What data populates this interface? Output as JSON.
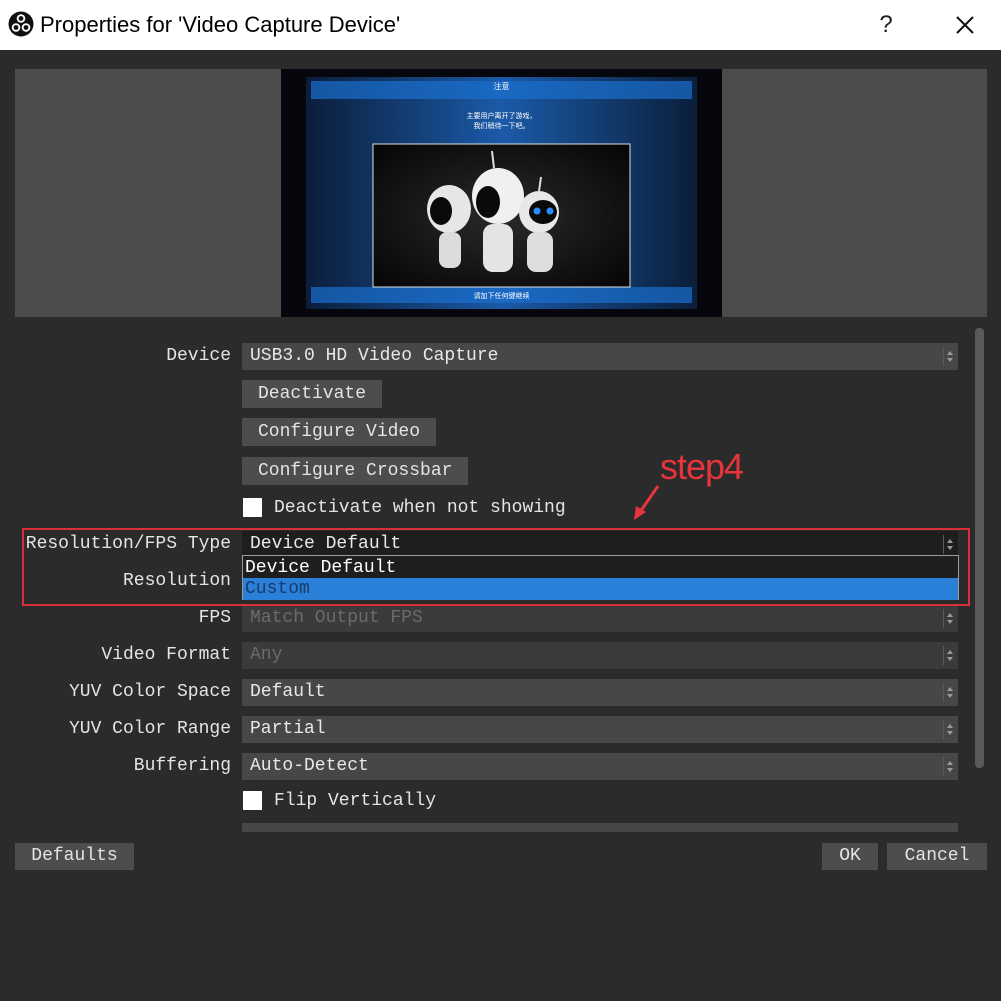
{
  "window": {
    "title": "Properties for 'Video Capture Device'",
    "help_glyph": "?"
  },
  "preview": {
    "header_text": "注意",
    "message_line1": "主要用户离开了游戏，",
    "message_line2": "我们稍待一下吧。",
    "footer_text": "请加下任何键继续"
  },
  "properties": {
    "device": {
      "label": "Device",
      "value": "USB3.0 HD Video Capture"
    },
    "deactivate_button": "Deactivate",
    "configure_video_button": "Configure Video",
    "configure_crossbar_button": "Configure Crossbar",
    "deactivate_when_not_showing": {
      "label": "Deactivate when not showing",
      "checked": false
    },
    "resolution_fps_type": {
      "label": "Resolution/FPS Type",
      "value": "Device Default",
      "options": [
        "Device Default",
        "Custom"
      ],
      "highlighted_option": "Custom"
    },
    "resolution": {
      "label": "Resolution"
    },
    "fps": {
      "label": "FPS",
      "value": "Match Output FPS"
    },
    "video_format": {
      "label": "Video Format",
      "value": "Any"
    },
    "yuv_color_space": {
      "label": "YUV Color Space",
      "value": "Default"
    },
    "yuv_color_range": {
      "label": "YUV Color Range",
      "value": "Partial"
    },
    "buffering": {
      "label": "Buffering",
      "value": "Auto-Detect"
    },
    "flip_vertically": {
      "label": "Flip Vertically",
      "checked": false
    }
  },
  "annotation": {
    "text": "step4",
    "color": "#e8343c"
  },
  "footer": {
    "defaults_button": "Defaults",
    "ok_button": "OK",
    "cancel_button": "Cancel"
  },
  "colors": {
    "background": "#2b2b2b",
    "control": "#474747",
    "selection": "#2a80d8",
    "highlight": "#d8303a"
  }
}
